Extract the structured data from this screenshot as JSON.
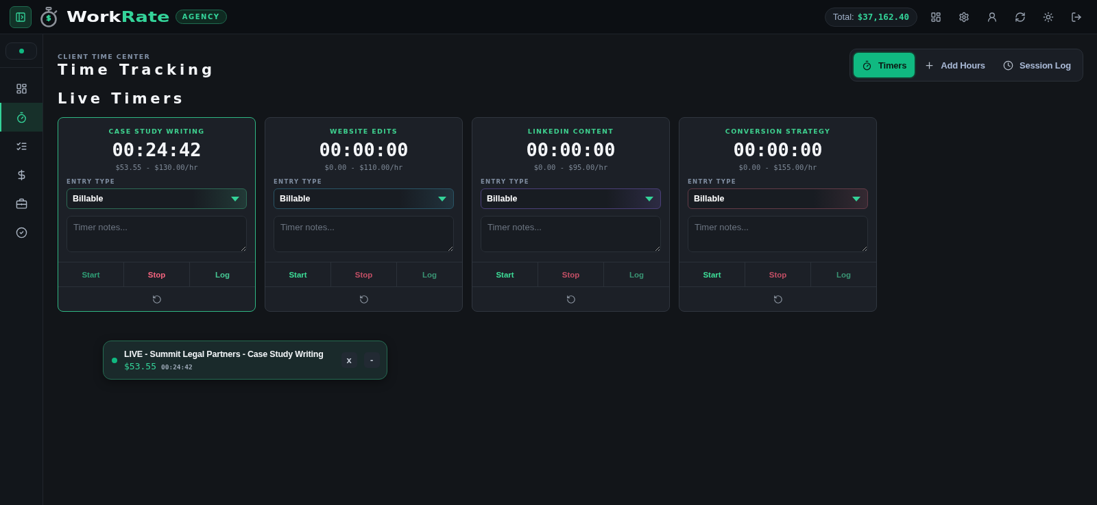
{
  "topbar": {
    "brand": {
      "text": "Work",
      "accent_text": "Rate"
    },
    "badge": "AGENCY",
    "total": {
      "label": "Total:",
      "value": "$37,162.40"
    }
  },
  "sidebar": {
    "items": [
      {
        "selected": false
      },
      {
        "selected": true
      },
      {
        "selected": false
      },
      {
        "selected": false
      },
      {
        "selected": false
      },
      {
        "selected": false
      }
    ]
  },
  "header": {
    "eyebrow": "CLIENT TIME CENTER",
    "title": "Time Tracking"
  },
  "tabs": [
    {
      "label": "Timers",
      "selected": true
    },
    {
      "label": "Add Hours",
      "selected": false
    },
    {
      "label": "Session Log",
      "selected": false
    }
  ],
  "section_title": "Live Timers",
  "timers": [
    {
      "title": "CASE STUDY WRITING",
      "time": "00:24:42",
      "rate": "$53.55 - $130.00/hr",
      "running": true,
      "color": "#2d6a55",
      "entry_type": {
        "label": "ENTRY TYPE",
        "value": "Billable"
      },
      "notes": {
        "placeholder": "Timer notes..."
      },
      "buttons": [
        "Start",
        "Stop",
        "Log"
      ]
    },
    {
      "title": "WEBSITE EDITS",
      "time": "00:00:00",
      "rate": "$0.00 - $110.00/hr",
      "running": false,
      "color": "#2a5566",
      "entry_type": {
        "label": "ENTRY TYPE",
        "value": "Billable"
      },
      "notes": {
        "placeholder": "Timer notes..."
      },
      "buttons": [
        "Start",
        "Stop",
        "Log"
      ]
    },
    {
      "title": "LINKEDIN CONTENT",
      "time": "00:00:00",
      "rate": "$0.00 - $95.00/hr",
      "running": false,
      "color": "#4b3f78",
      "entry_type": {
        "label": "ENTRY TYPE",
        "value": "Billable"
      },
      "notes": {
        "placeholder": "Timer notes..."
      },
      "buttons": [
        "Start",
        "Stop",
        "Log"
      ]
    },
    {
      "title": "CONVERSION STRATEGY",
      "time": "00:00:00",
      "rate": "$0.00 - $155.00/hr",
      "running": false,
      "color": "#633b47",
      "entry_type": {
        "label": "ENTRY TYPE",
        "value": "Billable"
      },
      "notes": {
        "placeholder": "Timer notes..."
      },
      "buttons": [
        "Start",
        "Stop",
        "Log"
      ]
    }
  ],
  "live_widget": {
    "title": "LIVE - Summit Legal Partners - Case Study Writing",
    "amount": "$53.55",
    "time": "00:24:42",
    "buttons": [
      "x",
      "-"
    ]
  }
}
